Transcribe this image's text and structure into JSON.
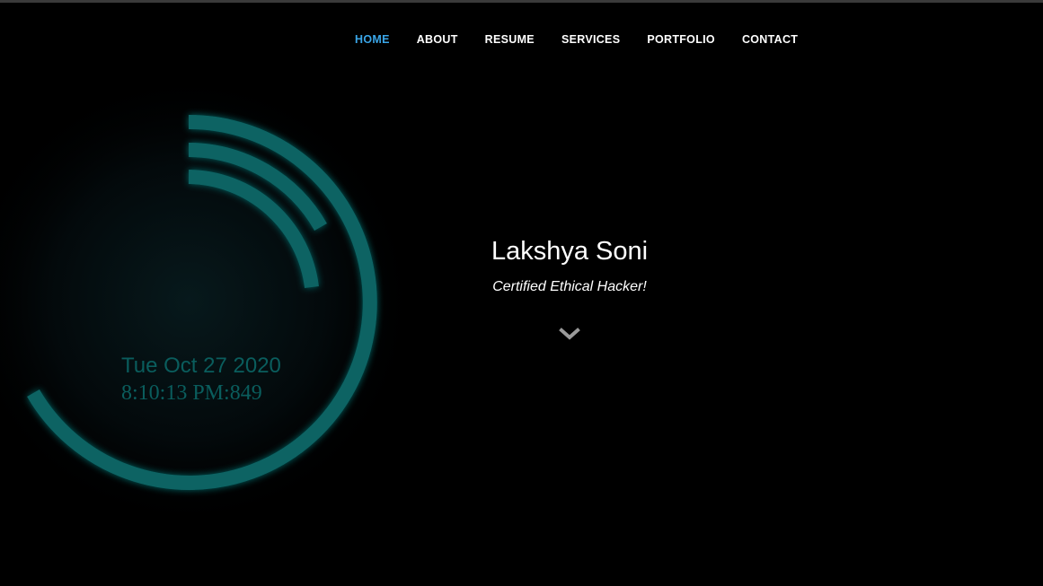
{
  "nav": {
    "items": [
      {
        "label": "HOME",
        "active": true
      },
      {
        "label": "ABOUT",
        "active": false
      },
      {
        "label": "RESUME",
        "active": false
      },
      {
        "label": "SERVICES",
        "active": false
      },
      {
        "label": "PORTFOLIO",
        "active": false
      },
      {
        "label": "CONTACT",
        "active": false
      }
    ],
    "active_color": "#3aa6e8"
  },
  "clock": {
    "date": "Tue Oct 27 2020",
    "time": "8:10:13 PM:849",
    "color": "#0a6464"
  },
  "hero": {
    "name": "Lakshya Soni",
    "title": "Certified Ethical Hacker!",
    "scroll_icon": "chevron-down-icon"
  }
}
